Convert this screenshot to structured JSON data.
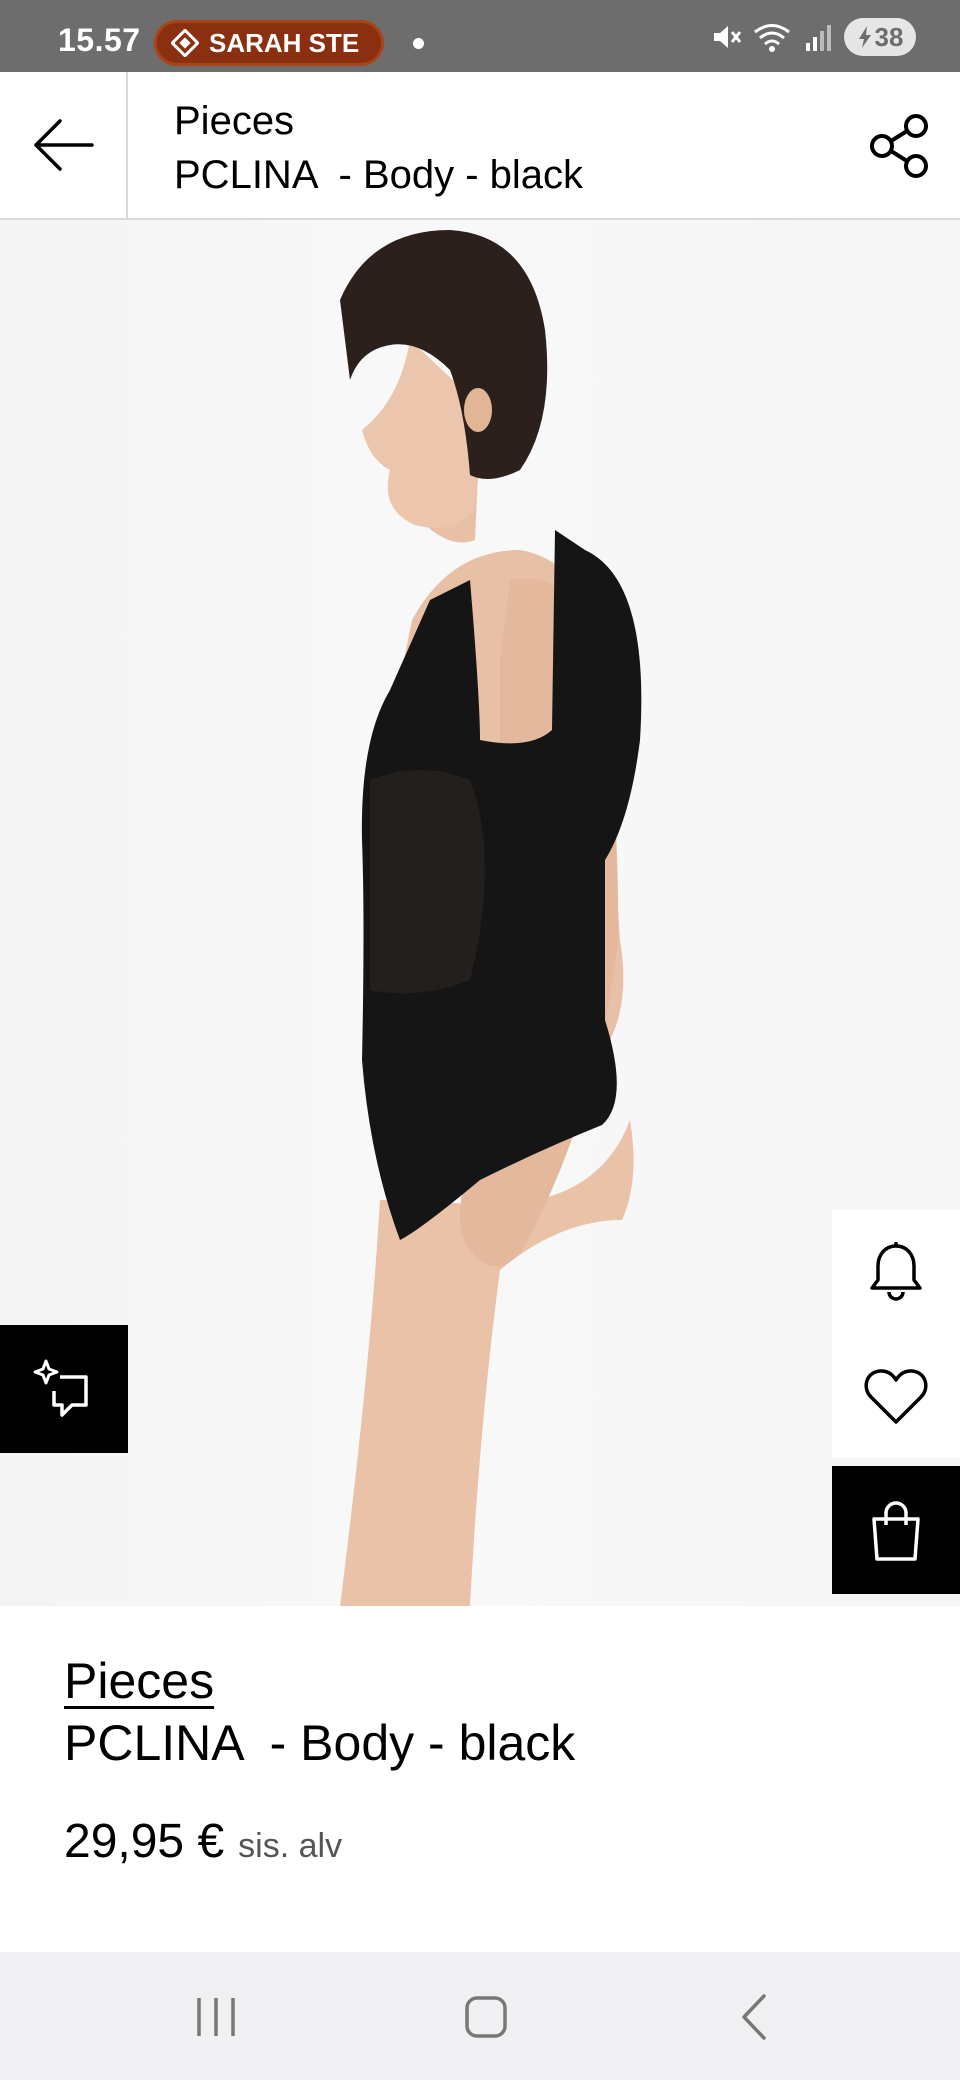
{
  "status_bar": {
    "time": "15.57",
    "notification_pill": "SARAH STE",
    "battery": "38"
  },
  "header": {
    "brand": "Pieces",
    "product_name": "PCLINA  - Body - black"
  },
  "product": {
    "brand": "Pieces",
    "name": "PCLINA  - Body - black",
    "price": "29,95 €",
    "vat_note": "sis. alv",
    "gallery_position": 1
  },
  "icons": {
    "back": "arrow-left-icon",
    "share": "share-icon",
    "bell": "bell-icon",
    "heart": "heart-icon",
    "bag": "shopping-bag-icon",
    "ai": "sparkle-tag-icon"
  },
  "colors": {
    "status_bar": "#6d6d6d",
    "pill": "#8a2f10",
    "accent": "#000000",
    "nav_bar": "#f0f0f2"
  }
}
